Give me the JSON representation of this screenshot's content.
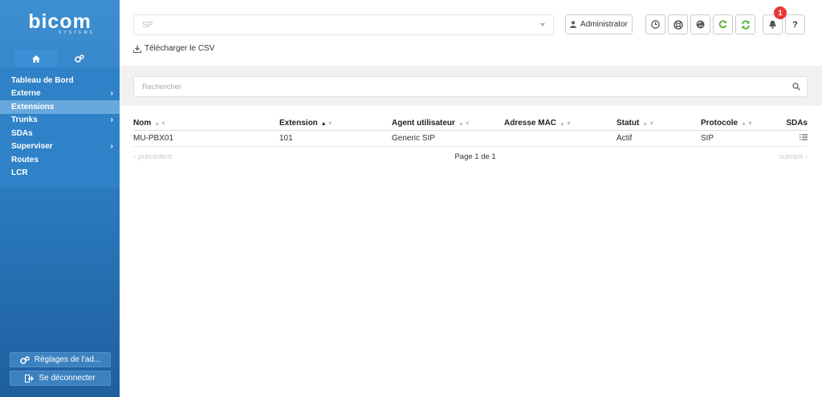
{
  "sidebar": {
    "logo": "bicom",
    "logo_sub": "SYSTEMS",
    "items": [
      {
        "label": "Tableau de Bord",
        "chevron": ""
      },
      {
        "label": "Externe",
        "chevron": "›"
      },
      {
        "label": "Extensions",
        "chevron": ""
      },
      {
        "label": "Trunks",
        "chevron": "›"
      },
      {
        "label": "SDAs",
        "chevron": ""
      },
      {
        "label": "Superviser",
        "chevron": "›"
      },
      {
        "label": "Routes",
        "chevron": ""
      },
      {
        "label": "LCR",
        "chevron": ""
      }
    ],
    "active_item": "Extensions",
    "settings_label": "Réglages de l'ad...",
    "logout_label": "Se déconnecter"
  },
  "header": {
    "tenant_select_value": "SP",
    "admin_label": "Administrator",
    "notification_count": "1",
    "help_label": "?",
    "csv_label": "Télécharger le CSV"
  },
  "search": {
    "placeholder": "Rechercher"
  },
  "table": {
    "columns": [
      "Nom",
      "Extension",
      "Agent utilisateur",
      "Adresse MAC",
      "Statut",
      "Protocole",
      "SDAs"
    ],
    "rows": [
      {
        "nom": "MU-PBX01",
        "extension": "101",
        "agent": "Generic SIP",
        "mac": "",
        "statut": "Actif",
        "protocole": "SIP"
      }
    ]
  },
  "pagination": {
    "prev": "précédent",
    "info": "Page 1 de 1",
    "next": "suivant"
  },
  "colors": {
    "sidebar": "#2f82c7",
    "active": "#69a8dc",
    "green": "#4caf2a",
    "badge": "#e53935"
  }
}
